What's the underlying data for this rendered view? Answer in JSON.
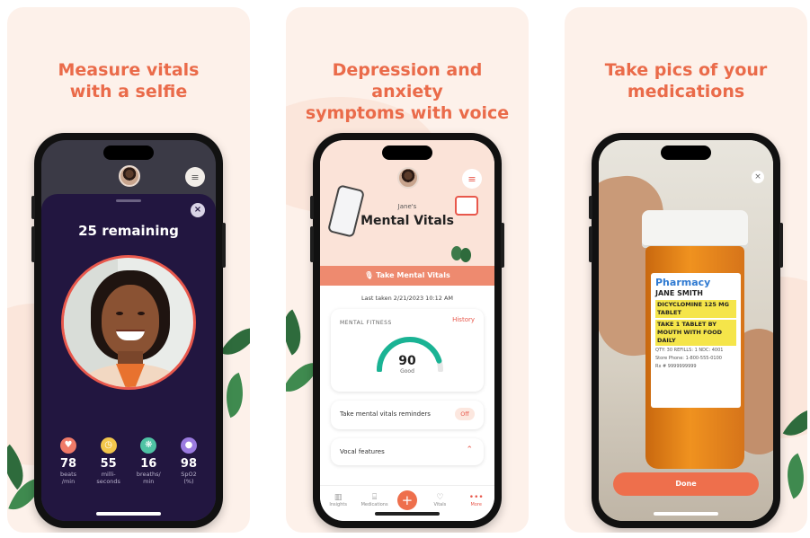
{
  "panels": [
    {
      "headline_line1": "Measure vitals",
      "headline_line2": "with a selfie",
      "remaining": "25 remaining",
      "vitals": [
        {
          "value": "78",
          "unit_line1": "beats",
          "unit_line2": "/min",
          "icon": "heart-icon",
          "color": "#f07a68"
        },
        {
          "value": "55",
          "unit_line1": "milli-",
          "unit_line2": "seconds",
          "icon": "stopwatch-icon",
          "color": "#f3c64b"
        },
        {
          "value": "16",
          "unit_line1": "breaths/",
          "unit_line2": "min",
          "icon": "lungs-icon",
          "color": "#4fc3a4"
        },
        {
          "value": "98",
          "unit_line1": "SpO2",
          "unit_line2": "(%)",
          "icon": "droplet-icon",
          "color": "#9b7be0"
        }
      ]
    },
    {
      "headline_line1": "Depression and anxiety",
      "headline_line2": "symptoms with voice",
      "subtitle": "Jane's",
      "title": "Mental Vitals",
      "cta": "Take Mental Vitals",
      "last_taken": "Last taken  2/21/2023  10:12 AM",
      "fitness_label": "MENTAL FITNESS",
      "history": "History",
      "score": "90",
      "score_label": "Good",
      "reminder_text": "Take mental vitals reminders",
      "reminder_toggle": "Off",
      "vocal_text": "Vocal features",
      "tabs": [
        {
          "label": "Insights",
          "icon": "chart-icon"
        },
        {
          "label": "Medications",
          "icon": "pill-icon"
        },
        {
          "label": "",
          "icon": "plus-icon"
        },
        {
          "label": "Vitals",
          "icon": "heart-icon"
        },
        {
          "label": "More",
          "icon": "more-icon"
        }
      ]
    },
    {
      "headline_line1": "Take pics of your",
      "headline_line2": "medications",
      "label_pharmacy": "Pharmacy",
      "label_patient": "JANE SMITH",
      "label_drug": "DICYCLOMINE 125 MG TABLET",
      "label_direction": "TAKE 1 TABLET BY MOUTH WITH FOOD DAILY",
      "label_refills": "QTY: 30   REFILLS: 1   NDC: 4001",
      "label_phone": "Store Phone: 1-800-555-0100",
      "label_rx": "Rx # 9999999999",
      "done": "Done"
    }
  ],
  "colors": {
    "accent": "#ea6b4a",
    "panel_bg": "#fdf1ea",
    "sheet": "#221640"
  }
}
